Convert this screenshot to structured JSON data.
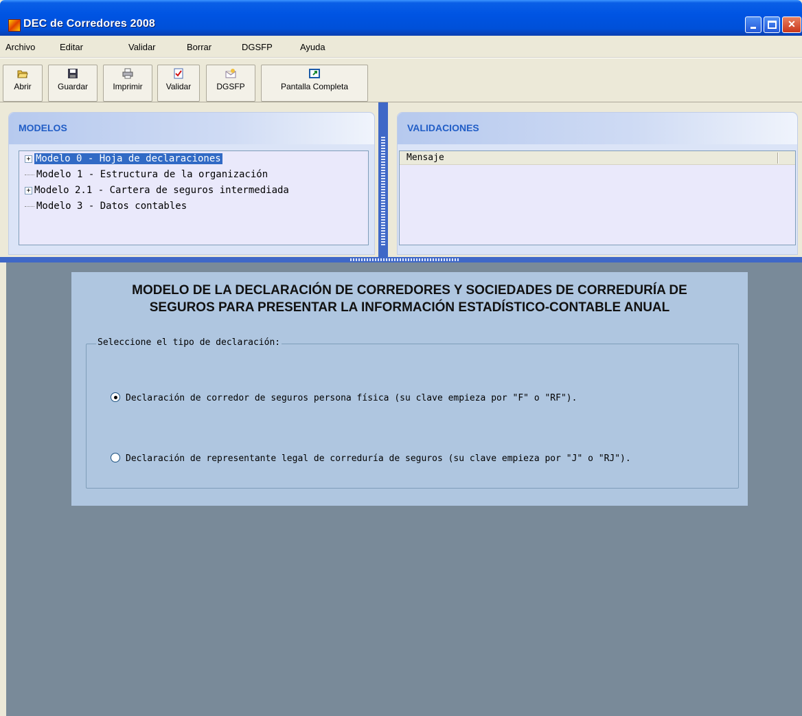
{
  "window": {
    "title": "DEC de Corredores 2008"
  },
  "menu": [
    {
      "label": "Archivo"
    },
    {
      "label": "Editar"
    },
    {
      "label": "Validar"
    },
    {
      "label": "Borrar"
    },
    {
      "label": "DGSFP"
    },
    {
      "label": "Ayuda"
    }
  ],
  "toolbar": {
    "abrir": "Abrir",
    "guardar": "Guardar",
    "imprimir": "Imprimir",
    "validar": "Validar",
    "dgsfp": "DGSFP",
    "pantalla_completa": "Pantalla Completa"
  },
  "modelos": {
    "title": "MODELOS",
    "items": [
      {
        "label": "Modelo 0 - Hoja de declaraciones",
        "expandable": true,
        "selected": true
      },
      {
        "label": "Modelo 1 - Estructura de la organización",
        "expandable": false
      },
      {
        "label": "Modelo 2.1 - Cartera de seguros intermediada",
        "expandable": true
      },
      {
        "label": "Modelo 3 - Datos contables",
        "expandable": false
      }
    ]
  },
  "validaciones": {
    "title": "VALIDACIONES",
    "column_header": "Mensaje"
  },
  "form": {
    "title_line1": "MODELO DE LA DECLARACIÓN DE CORREDORES Y SOCIEDADES DE CORREDURÍA DE",
    "title_line2": "SEGUROS PARA PRESENTAR LA INFORMACIÓN ESTADÍSTICO-CONTABLE ANUAL",
    "group_label": "Seleccione el tipo de declaración:",
    "options": [
      {
        "label": "Declaración de corredor de seguros persona física (su clave empieza por \"F\" o \"RF\").",
        "selected": true
      },
      {
        "label": "Declaración de representante legal de correduría de seguros (su clave empieza por \"J\" o \"RJ\").",
        "selected": false
      }
    ]
  },
  "colors": {
    "titlebar": "#0054e3",
    "panel_header_text": "#215dc6",
    "selection": "#316ac5",
    "workspace": "#798a99",
    "card": "#afc6e0"
  }
}
